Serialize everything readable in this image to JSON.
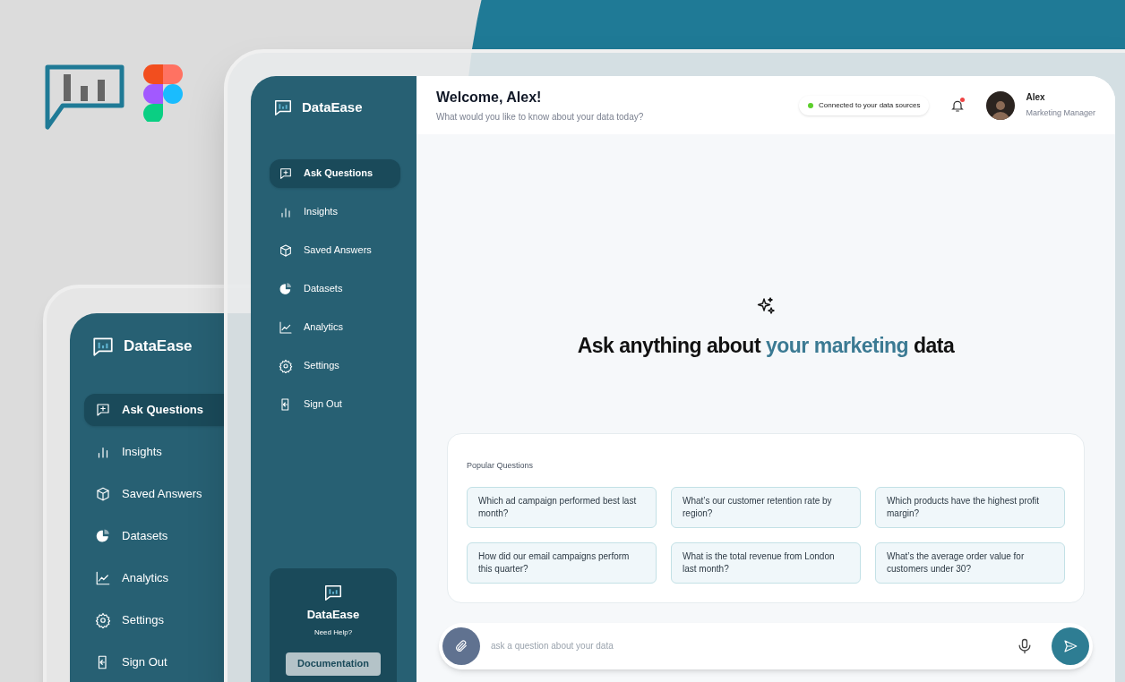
{
  "back_window": {
    "brand": "DataEase",
    "nav": [
      {
        "label": "Ask Questions",
        "selected": true
      },
      {
        "label": "Insights",
        "selected": false
      },
      {
        "label": "Saved Answers",
        "selected": false
      },
      {
        "label": "Datasets",
        "selected": false
      },
      {
        "label": "Analytics",
        "selected": false
      },
      {
        "label": "Settings",
        "selected": false
      },
      {
        "label": "Sign Out",
        "selected": false
      }
    ]
  },
  "front_window": {
    "sidebar": {
      "brand": "DataEase",
      "nav": [
        {
          "label": "Ask Questions",
          "selected": true
        },
        {
          "label": "Insights",
          "selected": false
        },
        {
          "label": "Saved Answers",
          "selected": false
        },
        {
          "label": "Datasets",
          "selected": false
        },
        {
          "label": "Analytics",
          "selected": false
        },
        {
          "label": "Settings",
          "selected": false
        },
        {
          "label": "Sign Out",
          "selected": false
        }
      ],
      "help_card": {
        "brand": "DataEase",
        "text": "Need Help?",
        "button": "Documentation"
      }
    },
    "header": {
      "title": "Welcome, Alex!",
      "subtitle": "What would you like to know about your data today?",
      "status": {
        "text": "Connected to your data sources",
        "connected": true
      },
      "notifications": {
        "unread": true
      },
      "user": {
        "name": "Alex",
        "role": "Marketing Manager"
      }
    },
    "hero": {
      "before": "Ask anything about ",
      "highlight": "your marketing",
      "after": " data"
    },
    "popular": {
      "title": "Popular Questions",
      "questions": [
        "Which ad campaign performed best last month?",
        "What’s our customer retention rate by region?",
        "Which products have the highest profit margin?",
        "How did our email campaigns perform this quarter?",
        "What is the total revenue from London last month?",
        "What’s the average order value for customers under 30?"
      ]
    },
    "composer": {
      "placeholder": "ask a question about your data"
    }
  }
}
